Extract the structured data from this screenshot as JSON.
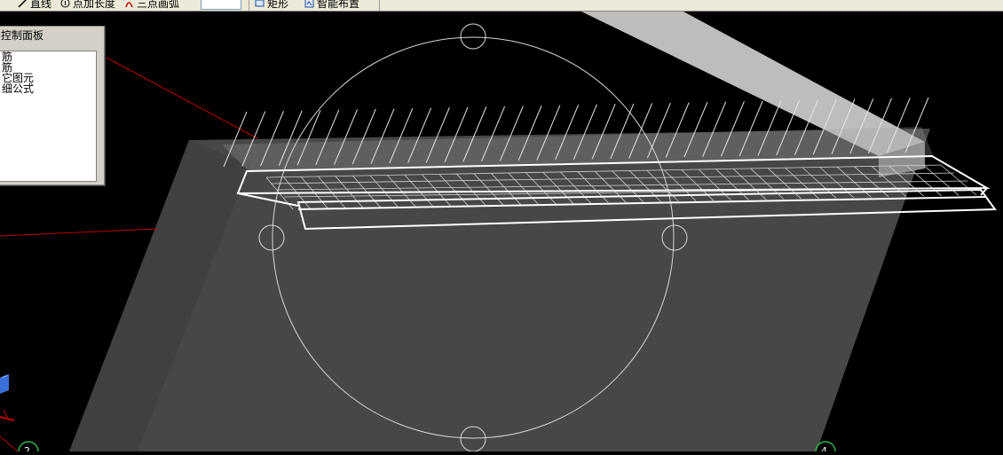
{
  "toolbar": {
    "items": [
      {
        "icon": "line-icon",
        "label": "直线"
      },
      {
        "icon": "point-angle-icon",
        "label": "点加长度"
      },
      {
        "icon": "three-point-arc-icon",
        "label": "三点画弧"
      },
      {
        "icon": "rectangle-icon",
        "label": "矩形"
      },
      {
        "icon": "smart-layout-icon",
        "label": "智能布置"
      }
    ]
  },
  "control_panel": {
    "title": "控制面板",
    "items": [
      "筋",
      "筋",
      "它图元",
      "细公式"
    ]
  },
  "viewport": {
    "background": "#000000",
    "slab_color": "#474747",
    "wireframe_color": "#FFFFFF",
    "axis_color": "#C00000",
    "grid_markers": [
      "2",
      "4"
    ]
  }
}
